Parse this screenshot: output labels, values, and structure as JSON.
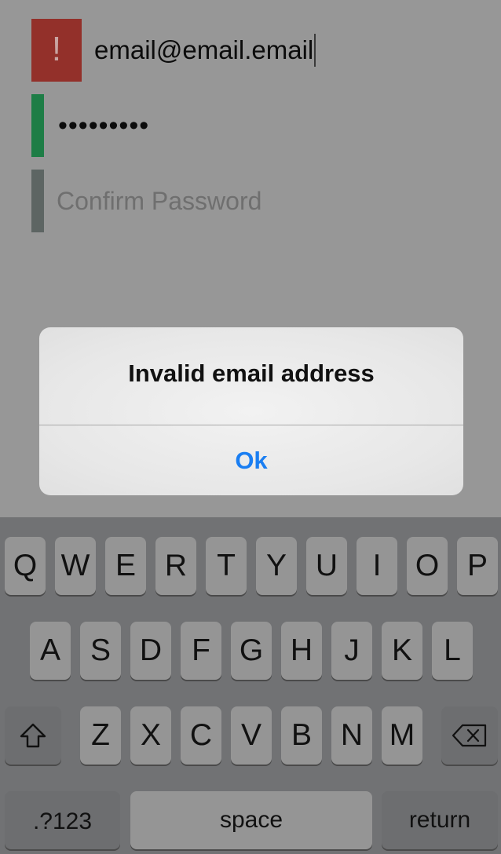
{
  "form": {
    "email": {
      "value": "email@email.email",
      "status_icon": "!"
    },
    "password": {
      "value": "•••••••••"
    },
    "confirm_password": {
      "placeholder": "Confirm Password"
    }
  },
  "alert": {
    "title": "Invalid email address",
    "button_label": "Ok"
  },
  "keyboard": {
    "row1": [
      "Q",
      "W",
      "E",
      "R",
      "T",
      "Y",
      "U",
      "I",
      "O",
      "P"
    ],
    "row2": [
      "A",
      "S",
      "D",
      "F",
      "G",
      "H",
      "J",
      "K",
      "L"
    ],
    "row3": [
      "Z",
      "X",
      "C",
      "V",
      "B",
      "N",
      "M"
    ],
    "numbers_label": ".?123",
    "space_label": "space",
    "return_label": "return",
    "shift_icon": "shift-arrow-icon",
    "backspace_icon": "backspace-icon"
  },
  "colors": {
    "error": "#93302a",
    "valid": "#1e7d46",
    "neutral": "#5d6563",
    "alert_button": "#1a7ef2"
  }
}
